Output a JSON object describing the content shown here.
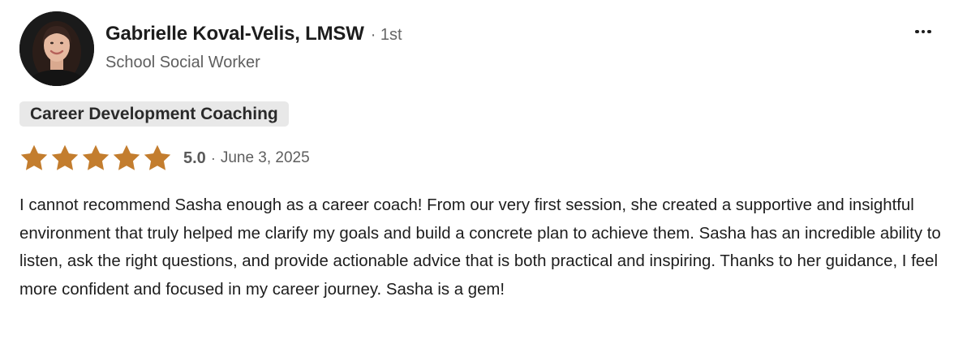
{
  "reviewer": {
    "name": "Gabrielle Koval-Velis, LMSW",
    "degree": "· 1st",
    "headline": "School Social Worker"
  },
  "service_tag": "Career Development Coaching",
  "rating": {
    "stars": 5,
    "score": "5.0",
    "separator": "·",
    "date": "June 3, 2025",
    "star_color": "#c37d2e"
  },
  "review_text": "I cannot recommend Sasha enough as a career coach! From our very first session, she created a supportive and insightful environment that truly helped me clarify my goals and build a concrete plan to achieve them. Sasha has an incredible ability to listen, ask the right questions, and provide actionable advice that is both practical and inspiring. Thanks to her guidance, I feel more confident and focused in my career journey. Sasha is a gem!",
  "icons": {
    "more": "more-horizontal-icon",
    "star": "star-icon"
  }
}
